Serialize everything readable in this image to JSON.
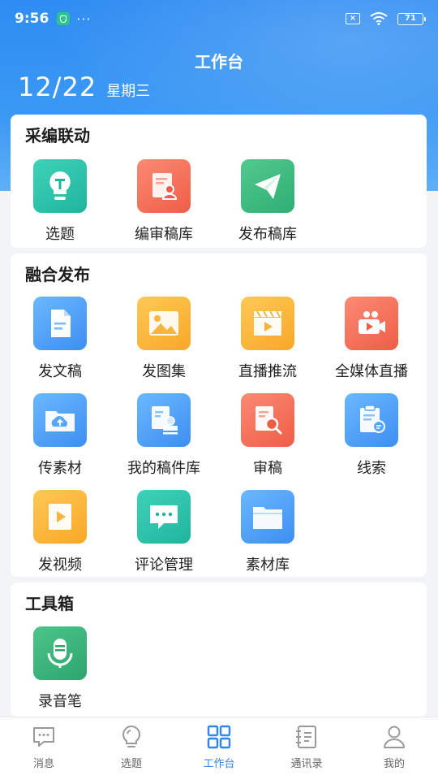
{
  "status_bar": {
    "time": "9:56",
    "dots": "···",
    "sim": "×",
    "battery": "71"
  },
  "header": {
    "title": "工作台",
    "date": "12/22",
    "weekday": "星期三"
  },
  "sections": [
    {
      "title": "采编联动",
      "items": [
        {
          "label": "选题",
          "icon": "lightbulb-icon"
        },
        {
          "label": "编审稿库",
          "icon": "editor-profile-icon"
        },
        {
          "label": "发布稿库",
          "icon": "paper-plane-icon"
        }
      ]
    },
    {
      "title": "融合发布",
      "items": [
        {
          "label": "发文稿",
          "icon": "document-icon"
        },
        {
          "label": "发图集",
          "icon": "image-icon"
        },
        {
          "label": "直播推流",
          "icon": "clapperboard-icon"
        },
        {
          "label": "全媒体直播",
          "icon": "video-camera-icon"
        },
        {
          "label": "传素材",
          "icon": "cloud-upload-folder-icon"
        },
        {
          "label": "我的稿件库",
          "icon": "stamp-document-icon"
        },
        {
          "label": "审稿",
          "icon": "review-magnifier-icon"
        },
        {
          "label": "线索",
          "icon": "clipboard-chat-icon"
        },
        {
          "label": "发视频",
          "icon": "play-video-icon"
        },
        {
          "label": "评论管理",
          "icon": "comment-bubble-icon"
        },
        {
          "label": "素材库",
          "icon": "folder-icon"
        }
      ]
    },
    {
      "title": "工具箱",
      "items": [
        {
          "label": "录音笔",
          "icon": "microphone-icon"
        }
      ]
    }
  ],
  "tabbar": [
    {
      "label": "消息",
      "icon": "message-icon",
      "active": false
    },
    {
      "label": "选题",
      "icon": "bulb-outline-icon",
      "active": false
    },
    {
      "label": "工作台",
      "icon": "grid-icon",
      "active": true
    },
    {
      "label": "通讯录",
      "icon": "contacts-book-icon",
      "active": false
    },
    {
      "label": "我的",
      "icon": "person-icon",
      "active": false
    }
  ],
  "colors": {
    "accent": "#2f86ef",
    "header_bg": "#3a98f4",
    "tab_inactive": "#999999"
  }
}
